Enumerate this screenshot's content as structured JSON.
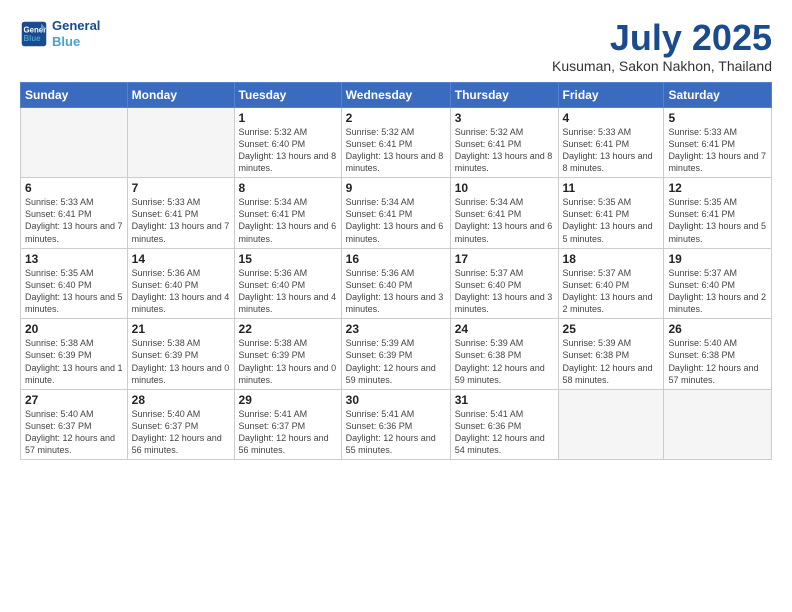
{
  "logo": {
    "line1": "General",
    "line2": "Blue"
  },
  "title": "July 2025",
  "subtitle": "Kusuman, Sakon Nakhon, Thailand",
  "weekdays": [
    "Sunday",
    "Monday",
    "Tuesday",
    "Wednesday",
    "Thursday",
    "Friday",
    "Saturday"
  ],
  "weeks": [
    [
      {
        "day": "",
        "info": ""
      },
      {
        "day": "",
        "info": ""
      },
      {
        "day": "1",
        "info": "Sunrise: 5:32 AM\nSunset: 6:40 PM\nDaylight: 13 hours and 8 minutes."
      },
      {
        "day": "2",
        "info": "Sunrise: 5:32 AM\nSunset: 6:41 PM\nDaylight: 13 hours and 8 minutes."
      },
      {
        "day": "3",
        "info": "Sunrise: 5:32 AM\nSunset: 6:41 PM\nDaylight: 13 hours and 8 minutes."
      },
      {
        "day": "4",
        "info": "Sunrise: 5:33 AM\nSunset: 6:41 PM\nDaylight: 13 hours and 8 minutes."
      },
      {
        "day": "5",
        "info": "Sunrise: 5:33 AM\nSunset: 6:41 PM\nDaylight: 13 hours and 7 minutes."
      }
    ],
    [
      {
        "day": "6",
        "info": "Sunrise: 5:33 AM\nSunset: 6:41 PM\nDaylight: 13 hours and 7 minutes."
      },
      {
        "day": "7",
        "info": "Sunrise: 5:33 AM\nSunset: 6:41 PM\nDaylight: 13 hours and 7 minutes."
      },
      {
        "day": "8",
        "info": "Sunrise: 5:34 AM\nSunset: 6:41 PM\nDaylight: 13 hours and 6 minutes."
      },
      {
        "day": "9",
        "info": "Sunrise: 5:34 AM\nSunset: 6:41 PM\nDaylight: 13 hours and 6 minutes."
      },
      {
        "day": "10",
        "info": "Sunrise: 5:34 AM\nSunset: 6:41 PM\nDaylight: 13 hours and 6 minutes."
      },
      {
        "day": "11",
        "info": "Sunrise: 5:35 AM\nSunset: 6:41 PM\nDaylight: 13 hours and 5 minutes."
      },
      {
        "day": "12",
        "info": "Sunrise: 5:35 AM\nSunset: 6:41 PM\nDaylight: 13 hours and 5 minutes."
      }
    ],
    [
      {
        "day": "13",
        "info": "Sunrise: 5:35 AM\nSunset: 6:40 PM\nDaylight: 13 hours and 5 minutes."
      },
      {
        "day": "14",
        "info": "Sunrise: 5:36 AM\nSunset: 6:40 PM\nDaylight: 13 hours and 4 minutes."
      },
      {
        "day": "15",
        "info": "Sunrise: 5:36 AM\nSunset: 6:40 PM\nDaylight: 13 hours and 4 minutes."
      },
      {
        "day": "16",
        "info": "Sunrise: 5:36 AM\nSunset: 6:40 PM\nDaylight: 13 hours and 3 minutes."
      },
      {
        "day": "17",
        "info": "Sunrise: 5:37 AM\nSunset: 6:40 PM\nDaylight: 13 hours and 3 minutes."
      },
      {
        "day": "18",
        "info": "Sunrise: 5:37 AM\nSunset: 6:40 PM\nDaylight: 13 hours and 2 minutes."
      },
      {
        "day": "19",
        "info": "Sunrise: 5:37 AM\nSunset: 6:40 PM\nDaylight: 13 hours and 2 minutes."
      }
    ],
    [
      {
        "day": "20",
        "info": "Sunrise: 5:38 AM\nSunset: 6:39 PM\nDaylight: 13 hours and 1 minute."
      },
      {
        "day": "21",
        "info": "Sunrise: 5:38 AM\nSunset: 6:39 PM\nDaylight: 13 hours and 0 minutes."
      },
      {
        "day": "22",
        "info": "Sunrise: 5:38 AM\nSunset: 6:39 PM\nDaylight: 13 hours and 0 minutes."
      },
      {
        "day": "23",
        "info": "Sunrise: 5:39 AM\nSunset: 6:39 PM\nDaylight: 12 hours and 59 minutes."
      },
      {
        "day": "24",
        "info": "Sunrise: 5:39 AM\nSunset: 6:38 PM\nDaylight: 12 hours and 59 minutes."
      },
      {
        "day": "25",
        "info": "Sunrise: 5:39 AM\nSunset: 6:38 PM\nDaylight: 12 hours and 58 minutes."
      },
      {
        "day": "26",
        "info": "Sunrise: 5:40 AM\nSunset: 6:38 PM\nDaylight: 12 hours and 57 minutes."
      }
    ],
    [
      {
        "day": "27",
        "info": "Sunrise: 5:40 AM\nSunset: 6:37 PM\nDaylight: 12 hours and 57 minutes."
      },
      {
        "day": "28",
        "info": "Sunrise: 5:40 AM\nSunset: 6:37 PM\nDaylight: 12 hours and 56 minutes."
      },
      {
        "day": "29",
        "info": "Sunrise: 5:41 AM\nSunset: 6:37 PM\nDaylight: 12 hours and 56 minutes."
      },
      {
        "day": "30",
        "info": "Sunrise: 5:41 AM\nSunset: 6:36 PM\nDaylight: 12 hours and 55 minutes."
      },
      {
        "day": "31",
        "info": "Sunrise: 5:41 AM\nSunset: 6:36 PM\nDaylight: 12 hours and 54 minutes."
      },
      {
        "day": "",
        "info": ""
      },
      {
        "day": "",
        "info": ""
      }
    ]
  ]
}
